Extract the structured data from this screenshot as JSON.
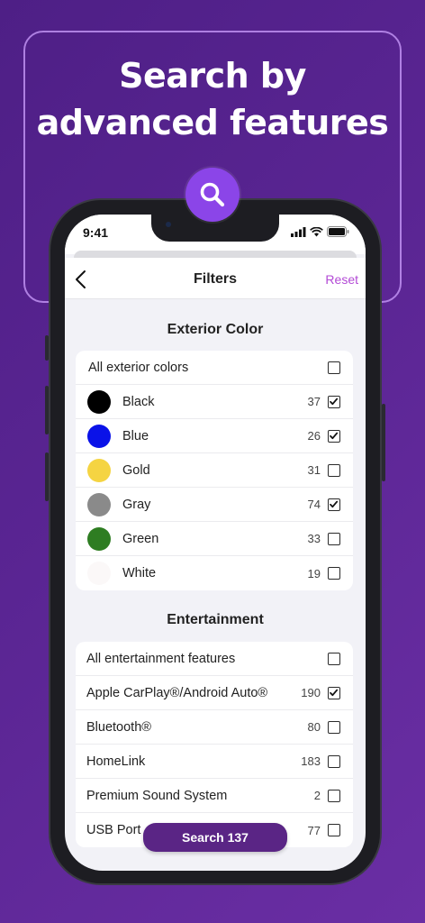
{
  "hero": {
    "title_line1": "Search by",
    "title_line2": "advanced features",
    "icon": "search-icon"
  },
  "status_bar": {
    "time": "9:41"
  },
  "nav": {
    "title": "Filters",
    "reset_label": "Reset",
    "back_icon": "chevron-left-icon"
  },
  "exterior": {
    "title": "Exterior Color",
    "all_label": "All exterior colors",
    "all_checked": false,
    "items": [
      {
        "label": "Black",
        "count": "37",
        "checked": true,
        "color": "#000000"
      },
      {
        "label": "Blue",
        "count": "26",
        "checked": true,
        "color": "#0a12e8"
      },
      {
        "label": "Gold",
        "count": "31",
        "checked": false,
        "color": "#f5d442"
      },
      {
        "label": "Gray",
        "count": "74",
        "checked": true,
        "color": "#8a8a8a"
      },
      {
        "label": "Green",
        "count": "33",
        "checked": false,
        "color": "#2e7d22"
      },
      {
        "label": "White",
        "count": "19",
        "checked": false,
        "color": "#fbf8f8"
      }
    ]
  },
  "entertainment": {
    "title": "Entertainment",
    "all_label": "All entertainment features",
    "all_checked": false,
    "items": [
      {
        "label": "Apple CarPlay®/Android Auto®",
        "count": "190",
        "checked": true
      },
      {
        "label": "Bluetooth®",
        "count": "80",
        "checked": false
      },
      {
        "label": "HomeLink",
        "count": "183",
        "checked": false
      },
      {
        "label": "Premium Sound System",
        "count": "2",
        "checked": false
      },
      {
        "label": "USB Port",
        "count": "77",
        "checked": false
      }
    ]
  },
  "search_button": {
    "label": "Search 137"
  },
  "colors": {
    "accent": "#b34ad6",
    "button": "#5a2585",
    "badge": "#8b45e8"
  }
}
